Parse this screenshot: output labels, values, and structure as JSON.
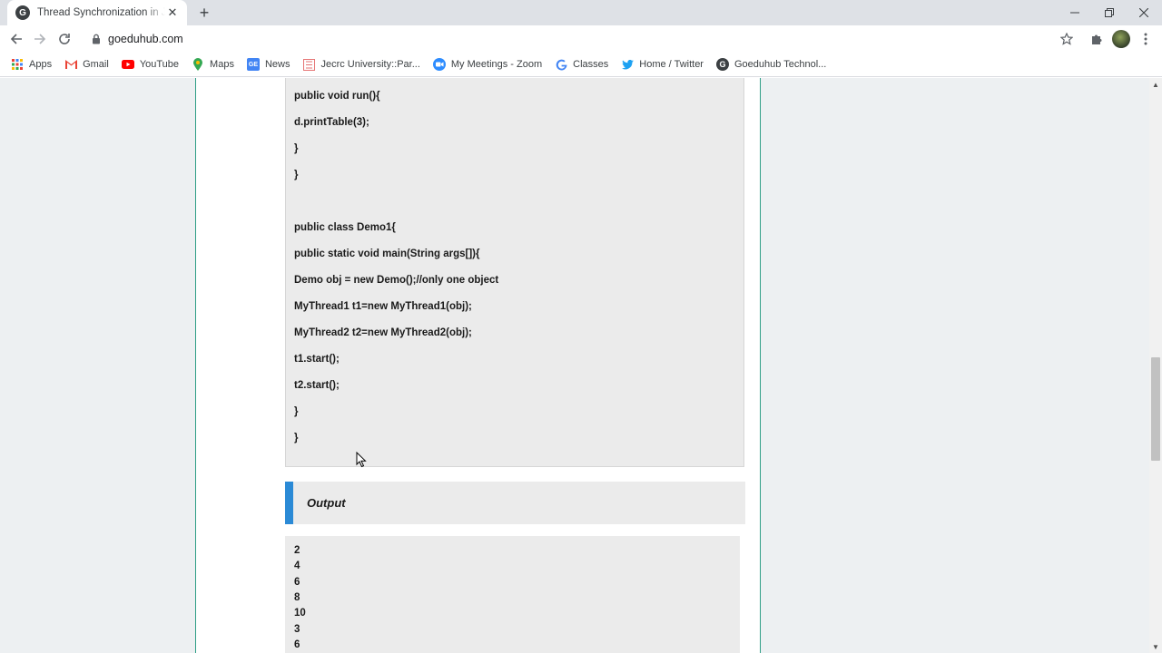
{
  "browser": {
    "tab": {
      "title": "Thread Synchronization in Java - ",
      "favicon_letter": "G"
    },
    "url": "goeduhub.com"
  },
  "bookmarks": [
    {
      "label": "Apps",
      "icon": "apps-grid-icon",
      "color": "#ea4335"
    },
    {
      "label": "Gmail",
      "icon": "gmail-icon",
      "color": "#ea4335"
    },
    {
      "label": "YouTube",
      "icon": "youtube-icon",
      "color": "#ff0000"
    },
    {
      "label": "Maps",
      "icon": "maps-icon",
      "color": "#34a853"
    },
    {
      "label": "News",
      "icon": "news-icon",
      "color": "#4285f4"
    },
    {
      "label": "Jecrc University::Par...",
      "icon": "jecrc-icon",
      "color": "#e57373"
    },
    {
      "label": "My Meetings - Zoom",
      "icon": "zoom-icon",
      "color": "#2d8cff"
    },
    {
      "label": "Classes",
      "icon": "google-icon",
      "color": "#4285f4"
    },
    {
      "label": "Home / Twitter",
      "icon": "twitter-icon",
      "color": "#1da1f2"
    },
    {
      "label": "Goeduhub Technol...",
      "icon": "goeduhub-icon",
      "color": "#3c4043"
    }
  ],
  "code_lines": [
    "public void run(){",
    "d.printTable(3);",
    "}",
    "}",
    "",
    "public class Demo1{",
    "public static void main(String args[]){",
    "Demo obj = new Demo();//only one object",
    "MyThread1 t1=new MyThread1(obj);",
    "MyThread2 t2=new MyThread2(obj);",
    "t1.start();",
    "t2.start();",
    "}",
    "}"
  ],
  "output_heading": "Output",
  "output_lines": [
    "2",
    "4",
    "6",
    "8",
    "10",
    "3",
    "6"
  ],
  "colors": {
    "accent_border": "#2e9e86",
    "output_bar": "#2b8ad6",
    "page_bg": "#edf0f2",
    "code_bg": "#ebebeb"
  }
}
